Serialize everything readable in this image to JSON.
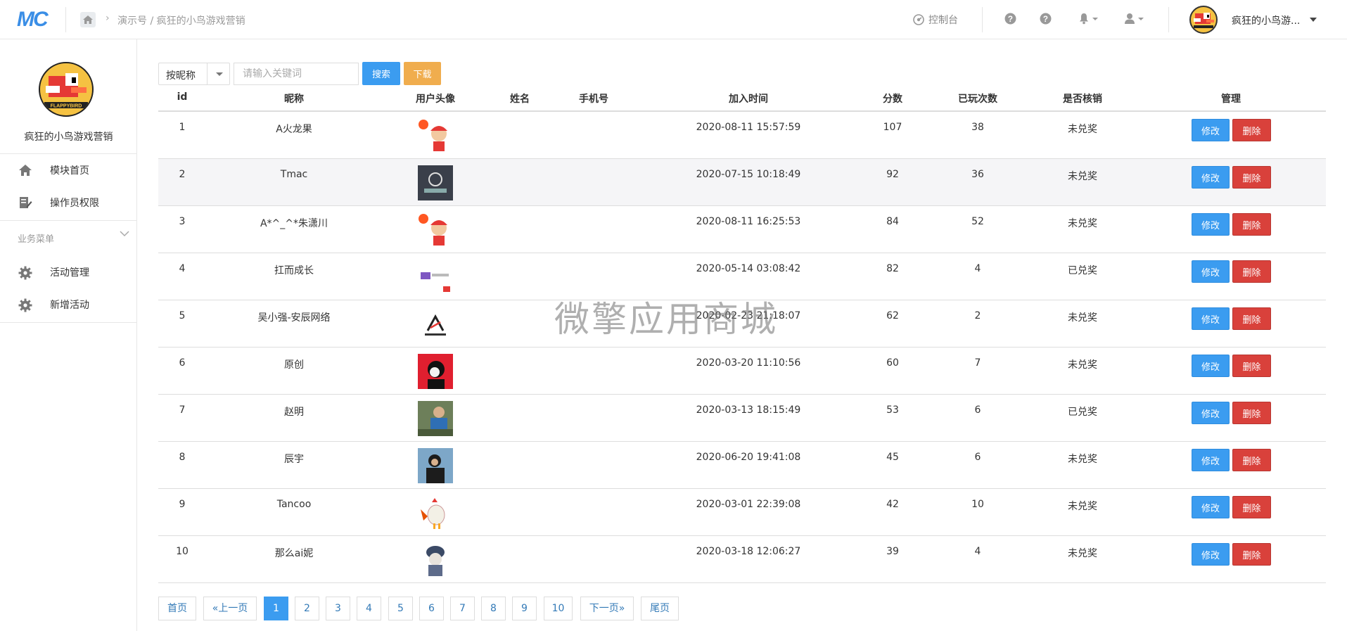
{
  "header": {
    "logo": "MC",
    "breadcrumb": "演示号 / 疯狂的小鸟游戏营销",
    "console_label": "控制台",
    "user_name": "疯狂的小鸟游..."
  },
  "sidebar": {
    "app_title": "疯狂的小鸟游戏营销",
    "logo_text": "FLAPPYBIRD",
    "items": [
      {
        "label": "模块首页",
        "icon": "home-icon"
      },
      {
        "label": "操作员权限",
        "icon": "edit-doc-icon"
      }
    ],
    "group_label": "业务菜单",
    "group_items": [
      {
        "label": "活动管理",
        "icon": "gear-icon"
      },
      {
        "label": "新增活动",
        "icon": "gear-icon"
      }
    ]
  },
  "toolbar": {
    "filter_value": "按昵称",
    "search_placeholder": "请输入关键词",
    "search_label": "搜索",
    "download_label": "下载"
  },
  "table": {
    "columns": [
      "id",
      "昵称",
      "用户头像",
      "姓名",
      "手机号",
      "加入时间",
      "分数",
      "已玩次数",
      "是否核销",
      "管理"
    ],
    "edit_label": "修改",
    "delete_label": "删除",
    "rows": [
      {
        "id": "1",
        "nickname": "A火龙果",
        "name": "",
        "phone": "",
        "joined": "2020-08-11 15:57:59",
        "score": "107",
        "plays": "38",
        "redeemed": "未兑奖"
      },
      {
        "id": "2",
        "nickname": "Tmac",
        "name": "",
        "phone": "",
        "joined": "2020-07-15 10:18:49",
        "score": "92",
        "plays": "36",
        "redeemed": "未兑奖"
      },
      {
        "id": "3",
        "nickname": "A*^_^*朱潇川",
        "name": "",
        "phone": "",
        "joined": "2020-08-11 16:25:53",
        "score": "84",
        "plays": "52",
        "redeemed": "未兑奖"
      },
      {
        "id": "4",
        "nickname": "扛而成长",
        "name": "",
        "phone": "",
        "joined": "2020-05-14 03:08:42",
        "score": "82",
        "plays": "4",
        "redeemed": "已兑奖"
      },
      {
        "id": "5",
        "nickname": "吴小强-安辰网络",
        "name": "",
        "phone": "",
        "joined": "2020-02-23 21:18:07",
        "score": "62",
        "plays": "2",
        "redeemed": "未兑奖"
      },
      {
        "id": "6",
        "nickname": "原创",
        "name": "",
        "phone": "",
        "joined": "2020-03-20 11:10:56",
        "score": "60",
        "plays": "7",
        "redeemed": "未兑奖"
      },
      {
        "id": "7",
        "nickname": "赵明",
        "name": "",
        "phone": "",
        "joined": "2020-03-13 18:15:49",
        "score": "53",
        "plays": "6",
        "redeemed": "已兑奖"
      },
      {
        "id": "8",
        "nickname": "辰宇",
        "name": "",
        "phone": "",
        "joined": "2020-06-20 19:41:08",
        "score": "45",
        "plays": "6",
        "redeemed": "未兑奖"
      },
      {
        "id": "9",
        "nickname": "Tancoo",
        "name": "",
        "phone": "",
        "joined": "2020-03-01 22:39:08",
        "score": "42",
        "plays": "10",
        "redeemed": "未兑奖"
      },
      {
        "id": "10",
        "nickname": "那么ai妮",
        "name": "",
        "phone": "",
        "joined": "2020-03-18 12:06:27",
        "score": "39",
        "plays": "4",
        "redeemed": "未兑奖"
      }
    ]
  },
  "pagination": {
    "first": "首页",
    "prev": "«上一页",
    "pages": [
      "1",
      "2",
      "3",
      "4",
      "5",
      "6",
      "7",
      "8",
      "9",
      "10"
    ],
    "active": "1",
    "next": "下一页»",
    "last": "尾页"
  },
  "watermark": "微擎应用商城",
  "colors": {
    "primary": "#3b9cf0",
    "warning": "#f0ad4e",
    "danger": "#d9413b"
  }
}
